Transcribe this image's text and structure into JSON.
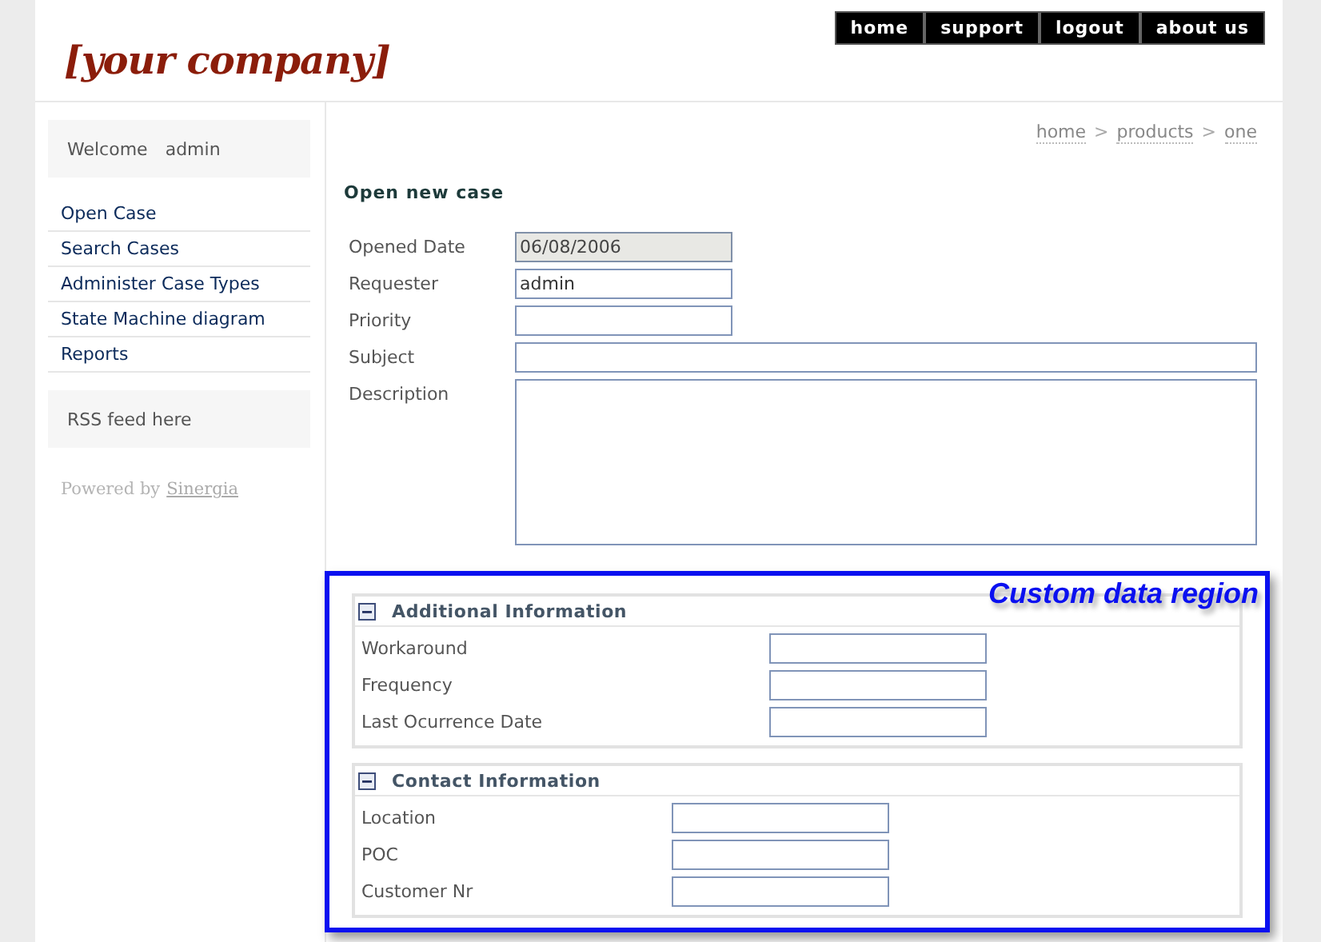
{
  "logo": "[your company]",
  "top_nav": [
    "home",
    "support",
    "logout",
    "about us"
  ],
  "sidebar": {
    "welcome": {
      "label": "Welcome",
      "user": "admin"
    },
    "menu": [
      "Open Case",
      "Search Cases",
      "Administer Case Types",
      "State Machine diagram",
      "Reports"
    ],
    "rss": "RSS feed here",
    "powered": {
      "text": "Powered by",
      "link": "Sinergia"
    }
  },
  "breadcrumb": {
    "items": [
      "home",
      "products",
      "one"
    ],
    "separator": ">"
  },
  "form": {
    "title": "Open new case",
    "fields": [
      {
        "label": "Opened Date",
        "value": "06/08/2006",
        "kind": "short",
        "disabled": true
      },
      {
        "label": "Requester",
        "value": "admin",
        "kind": "short",
        "disabled": false
      },
      {
        "label": "Priority",
        "kind": "short",
        "disabled": false
      },
      {
        "label": "Subject",
        "kind": "wide",
        "disabled": false
      },
      {
        "label": "Description",
        "kind": "area",
        "disabled": false
      }
    ]
  },
  "custom_region": {
    "caption": "Custom data region",
    "sections": [
      {
        "title": "Additional Information",
        "expanded": true,
        "fields": [
          "Workaround",
          "Frequency",
          "Last Ocurrence Date"
        ]
      },
      {
        "title": "Contact Information",
        "expanded": true,
        "fields": [
          "Location",
          "POC",
          "Customer Nr"
        ]
      }
    ]
  }
}
